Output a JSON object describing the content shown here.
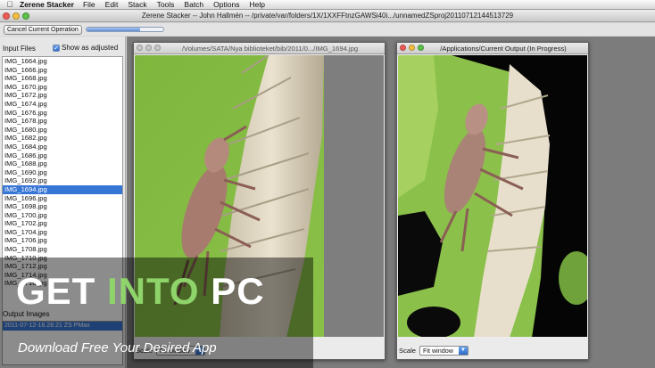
{
  "menubar": {
    "app_name": "Zerene Stacker",
    "items": [
      "File",
      "Edit",
      "Stack",
      "Tools",
      "Batch",
      "Options",
      "Help"
    ]
  },
  "window": {
    "title": "Zerene Stacker -- John Hallmén -- /private/var/folders/1X/1XXFFtnzGAWSi40i.../unnamedZSproj20110712144513729"
  },
  "toolbar": {
    "cancel_label": "Cancel Current Operation",
    "progress": 0.7
  },
  "left_panel": {
    "input_label": "Input Files",
    "show_adjusted_label": "Show as adjusted",
    "show_adjusted_checked": true,
    "files": [
      "IMG_1664.jpg",
      "IMG_1666.jpg",
      "IMG_1668.jpg",
      "IMG_1670.jpg",
      "IMG_1672.jpg",
      "IMG_1674.jpg",
      "IMG_1676.jpg",
      "IMG_1678.jpg",
      "IMG_1680.jpg",
      "IMG_1682.jpg",
      "IMG_1684.jpg",
      "IMG_1686.jpg",
      "IMG_1688.jpg",
      "IMG_1690.jpg",
      "IMG_1692.jpg",
      "IMG_1694.jpg",
      "IMG_1696.jpg",
      "IMG_1698.jpg",
      "IMG_1700.jpg",
      "IMG_1702.jpg",
      "IMG_1704.jpg",
      "IMG_1706.jpg",
      "IMG_1708.jpg",
      "IMG_1710.jpg",
      "IMG_1712.jpg",
      "IMG_1714.jpg",
      "IMG_1716.jpg"
    ],
    "selected_file": "IMG_1694.jpg",
    "output_label": "Output Images",
    "output_files": [
      "2011-07-12-16.28.21 ZS PMax"
    ]
  },
  "source_window": {
    "title": "/Volumes/SATA/Nya biblioteket/bib/2011/0.../IMG_1694.jpg",
    "scale_label": "Scale",
    "scale_value": "Fit window"
  },
  "output_window": {
    "title": "/Applications/Current Output (In Progress)",
    "scale_label": "Scale",
    "scale_value": "Fit window"
  },
  "watermark": {
    "get": "GET ",
    "into": "INTO",
    "pc": " PC",
    "sub": "Download Free Your Desired App"
  },
  "colors": {
    "selection": "#3876d6",
    "background_green": "#7fb73e",
    "watermark_green": "#8fd36b"
  }
}
